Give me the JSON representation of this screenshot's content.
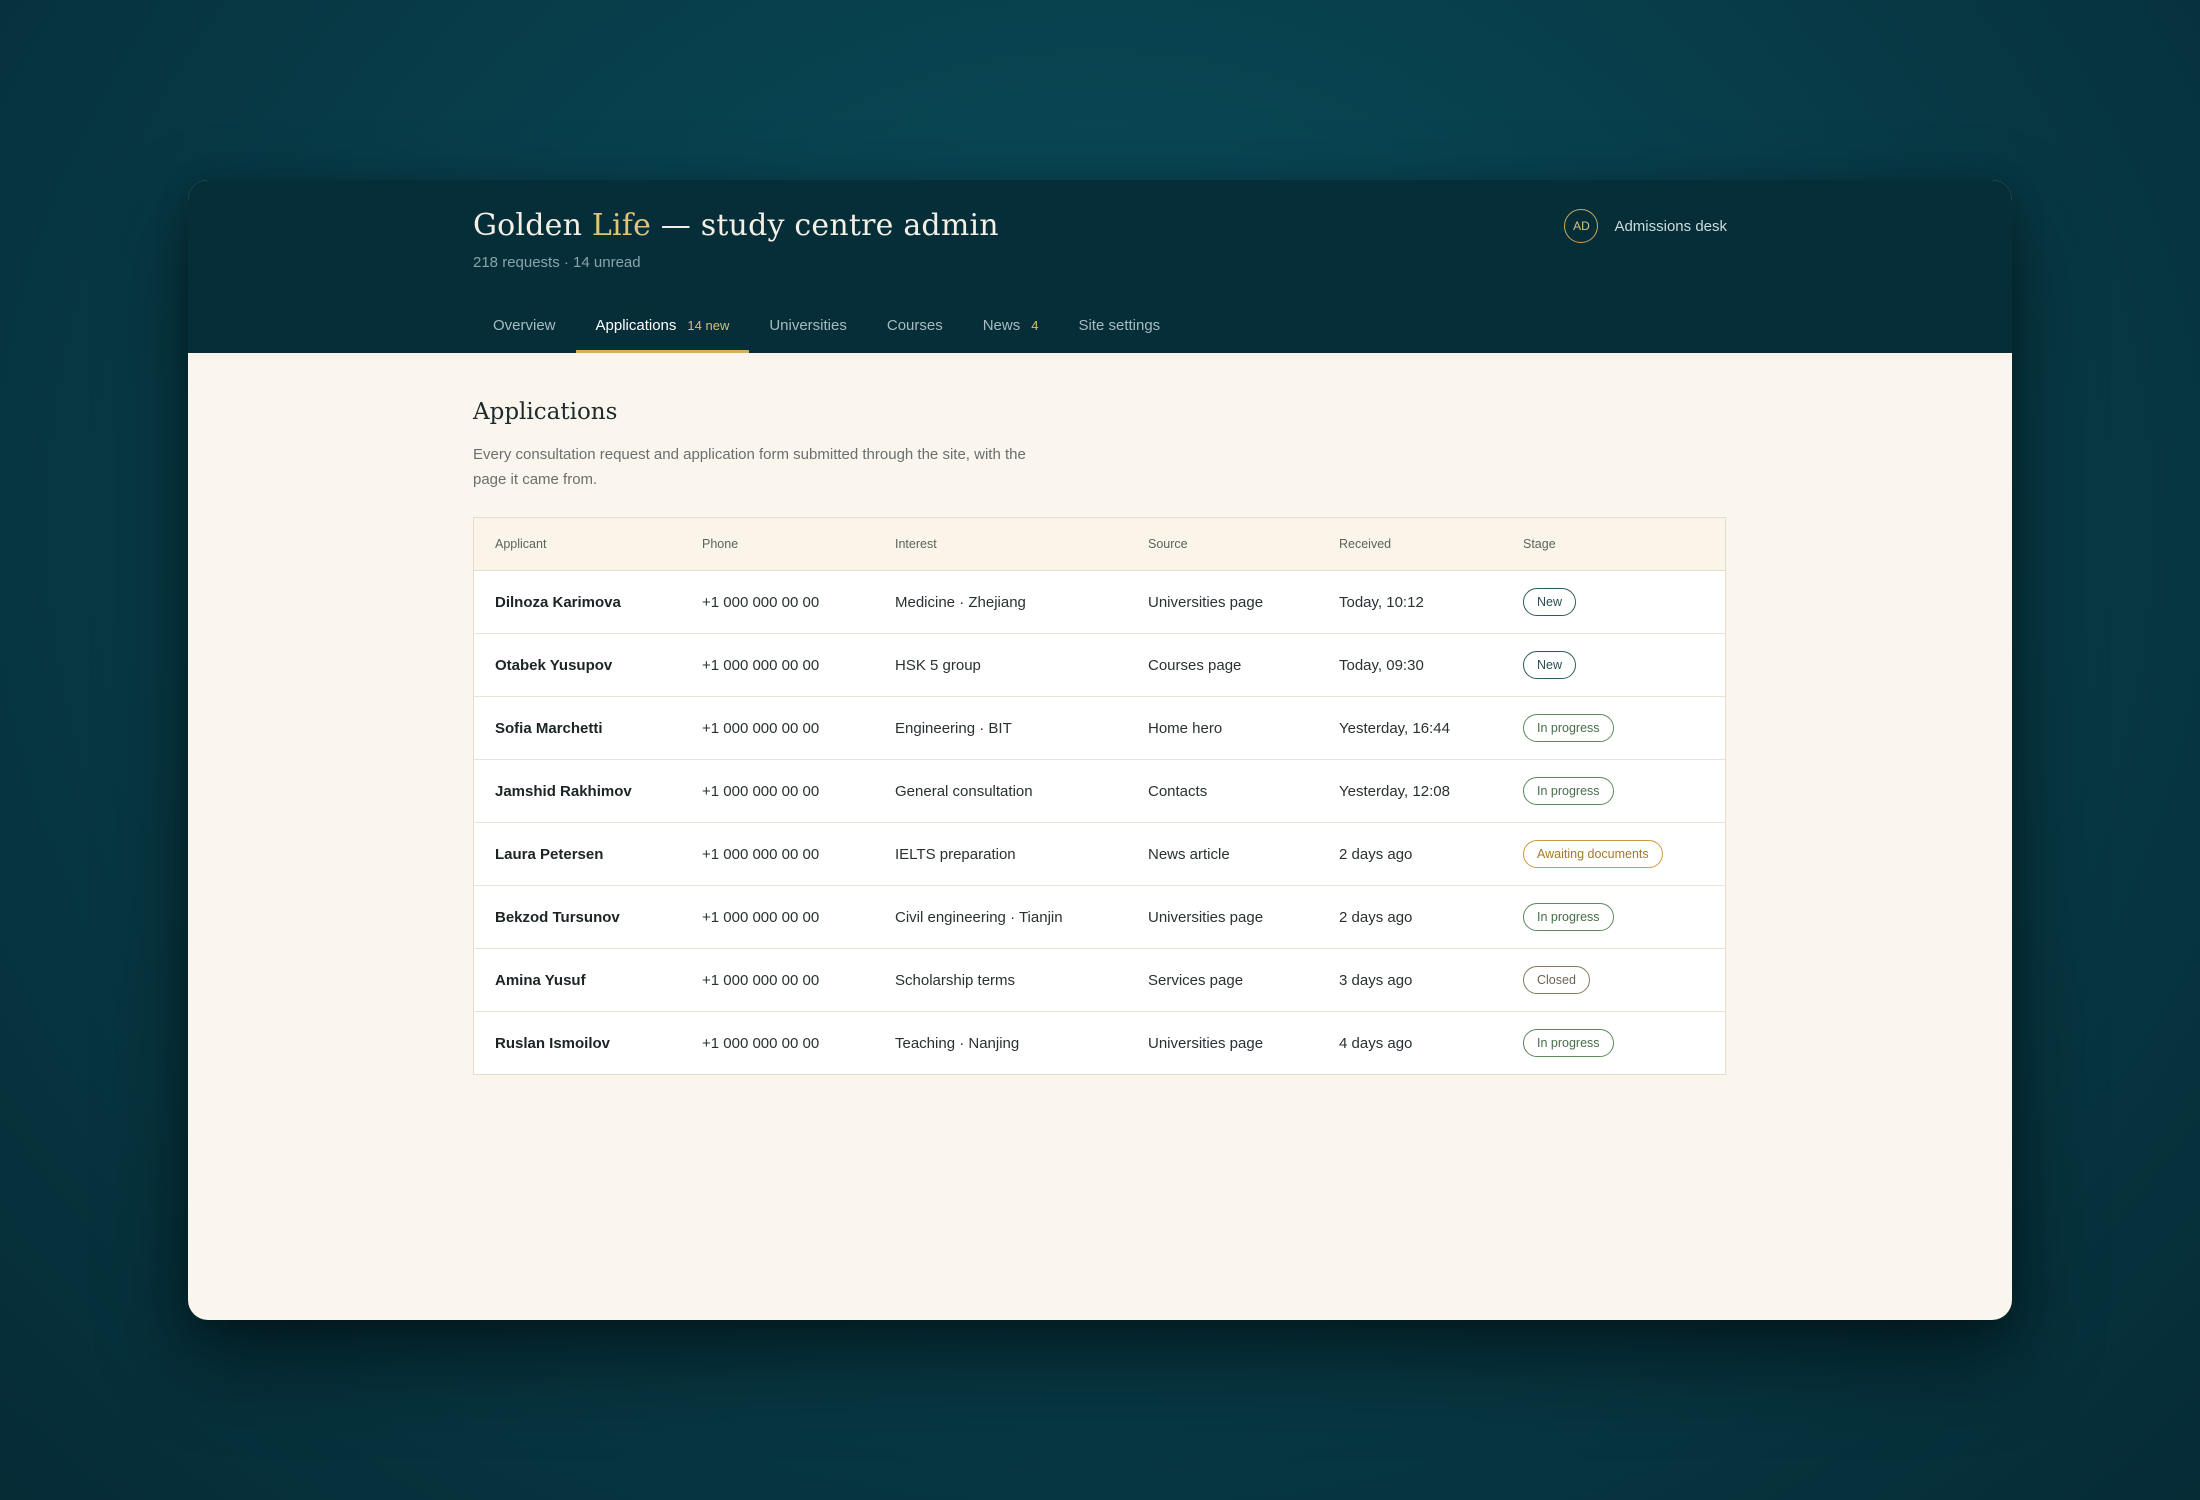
{
  "header": {
    "title_part1": "Golden ",
    "title_accent": "Life",
    "title_part2": " — study centre admin",
    "subtitle": "218 requests · 14 unread",
    "account": {
      "initials": "AD",
      "name": "Admissions desk"
    }
  },
  "tabs": [
    {
      "label": "Overview",
      "count": ""
    },
    {
      "label": "Applications",
      "count": "14 new",
      "active": true
    },
    {
      "label": "Universities",
      "count": ""
    },
    {
      "label": "Courses",
      "count": ""
    },
    {
      "label": "News",
      "count": "4"
    },
    {
      "label": "Site settings",
      "count": ""
    }
  ],
  "main": {
    "title": "Applications",
    "description": "Every consultation request and application form submitted through the site, with the page it came from."
  },
  "table": {
    "columns": [
      "Applicant",
      "Phone",
      "Interest",
      "Source",
      "Received",
      "Stage"
    ],
    "rows": [
      {
        "applicant": "Dilnoza Karimova",
        "phone": "+1 000 000 00 00",
        "interest": "Medicine · Zhejiang",
        "source": "Universities page",
        "received": "Today, 10:12",
        "stage": "New"
      },
      {
        "applicant": "Otabek Yusupov",
        "phone": "+1 000 000 00 00",
        "interest": "HSK 5 group",
        "source": "Courses page",
        "received": "Today, 09:30",
        "stage": "New"
      },
      {
        "applicant": "Sofia Marchetti",
        "phone": "+1 000 000 00 00",
        "interest": "Engineering · BIT",
        "source": "Home hero",
        "received": "Yesterday, 16:44",
        "stage": "In progress"
      },
      {
        "applicant": "Jamshid Rakhimov",
        "phone": "+1 000 000 00 00",
        "interest": "General consultation",
        "source": "Contacts",
        "received": "Yesterday, 12:08",
        "stage": "In progress"
      },
      {
        "applicant": "Laura Petersen",
        "phone": "+1 000 000 00 00",
        "interest": "IELTS preparation",
        "source": "News article",
        "received": "2 days ago",
        "stage": "Awaiting documents"
      },
      {
        "applicant": "Bekzod Tursunov",
        "phone": "+1 000 000 00 00",
        "interest": "Civil engineering · Tianjin",
        "source": "Universities page",
        "received": "2 days ago",
        "stage": "In progress"
      },
      {
        "applicant": "Amina Yusuf",
        "phone": "+1 000 000 00 00",
        "interest": "Scholarship terms",
        "source": "Services page",
        "received": "3 days ago",
        "stage": "Closed"
      },
      {
        "applicant": "Ruslan Ismoilov",
        "phone": "+1 000 000 00 00",
        "interest": "Teaching · Nanjing",
        "source": "Universities page",
        "received": "4 days ago",
        "stage": "In progress"
      }
    ]
  },
  "colors": {
    "background": "#083f4c",
    "topbar": "#062e39",
    "accent_gold": "#e0c37a",
    "content_bg": "#faf6ee"
  }
}
